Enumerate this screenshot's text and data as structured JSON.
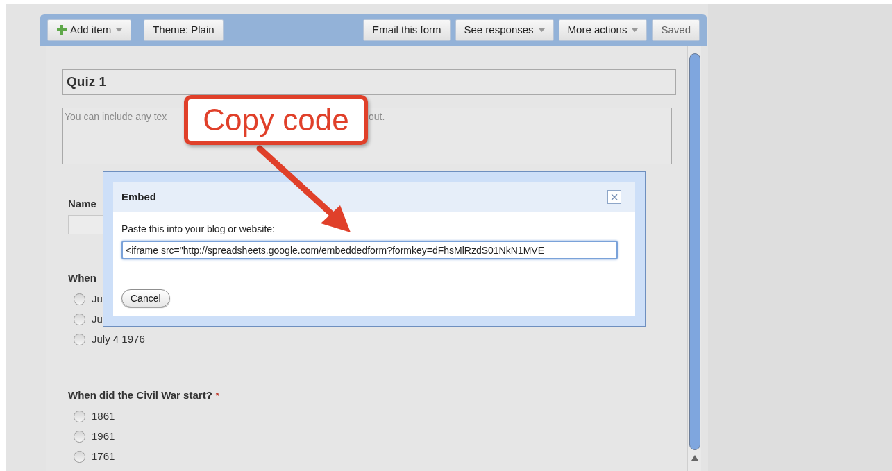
{
  "toolbar": {
    "left": [
      {
        "kind": "add",
        "label": "Add item",
        "dropdown": true,
        "disabled": false
      },
      {
        "kind": "plain",
        "label": "Theme:  Plain",
        "dropdown": false,
        "disabled": false
      }
    ],
    "right": [
      {
        "label": "Email this form",
        "dropdown": false,
        "disabled": false
      },
      {
        "label": "See responses",
        "dropdown": true,
        "disabled": false
      },
      {
        "label": "More actions",
        "dropdown": true,
        "disabled": false
      },
      {
        "label": "Saved",
        "dropdown": false,
        "disabled": true
      }
    ]
  },
  "form": {
    "title": "Quiz 1",
    "description_visible": [
      "You can include any tex",
      "out."
    ],
    "questions": [
      {
        "kind": "text",
        "title": "Name"
      },
      {
        "kind": "radio",
        "title": "When",
        "options": [
          {
            "label": "Ju",
            "selected": false
          },
          {
            "label": "Ju",
            "selected": false
          },
          {
            "label": "July 4 1976",
            "selected": false
          }
        ]
      },
      {
        "kind": "radio",
        "title": "When did the Civil War start?",
        "required_mark": "*",
        "options": [
          {
            "label": "1861",
            "selected": false
          },
          {
            "label": "1961",
            "selected": false
          },
          {
            "label": "1761",
            "selected": false
          }
        ]
      }
    ]
  },
  "dialog": {
    "title": "Embed",
    "close": "×",
    "prompt": "Paste this into your blog or website:",
    "code": "<iframe src=\"http://spreadsheets.google.com/embeddedform?formkey=dFhsMlRzdS01NkN1MVE",
    "cancel": "Cancel"
  },
  "callout": {
    "text": "Copy code"
  }
}
